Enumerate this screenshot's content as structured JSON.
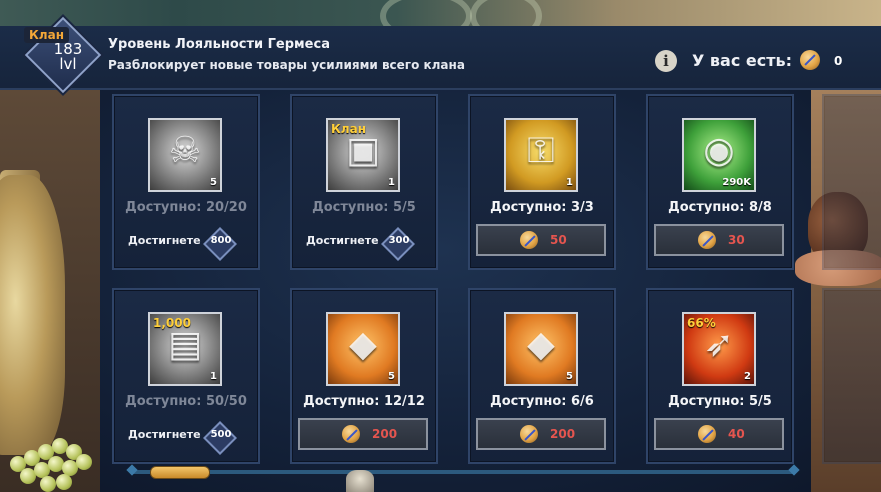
{
  "header": {
    "clan_tag": "Клан",
    "level": "183",
    "level_unit": "lvl",
    "title": "Уровень Лояльности Гермеса",
    "subtitle": "Разблокирует новые товары усилиями всего клана",
    "info_icon": "i",
    "have_label": "У вас есть:",
    "have_count": "0"
  },
  "items": [
    {
      "icon": "puzzle-skull-icon",
      "theme": "gray",
      "qty": "5",
      "corner": "",
      "available": "Доступно: 20/20",
      "locked": true,
      "reach_label": "Достигнете",
      "reach_value": "800"
    },
    {
      "icon": "chest-icon",
      "theme": "gray",
      "qty": "1",
      "corner": "Клан",
      "available": "Доступно: 5/5",
      "locked": true,
      "reach_label": "Достигнете",
      "reach_value": "300"
    },
    {
      "icon": "golden-key-icon",
      "theme": "gold",
      "qty": "1",
      "corner": "",
      "available": "Доступно: 3/3",
      "locked": false,
      "price": "50"
    },
    {
      "icon": "monster-mouth-icon",
      "theme": "green",
      "qty": "290K",
      "corner": "",
      "available": "Доступно: 8/8",
      "locked": false,
      "price": "30"
    },
    {
      "icon": "xp-book-icon",
      "theme": "gray",
      "qty": "1",
      "corner": "1,000",
      "available": "Доступно: 50/50",
      "locked": true,
      "reach_label": "Достигнете",
      "reach_value": "500"
    },
    {
      "icon": "puzzle-gem-icon",
      "theme": "orange",
      "qty": "5",
      "corner": "",
      "available": "Доступно: 12/12",
      "locked": false,
      "price": "200"
    },
    {
      "icon": "puzzle-gem-icon",
      "theme": "orange",
      "qty": "5",
      "corner": "",
      "available": "Доступно: 6/6",
      "locked": false,
      "price": "200"
    },
    {
      "icon": "winged-boot-icon",
      "theme": "red",
      "qty": "2",
      "corner": "66%",
      "available": "Доступно: 5/5",
      "locked": false,
      "price": "40"
    }
  ],
  "scroll": {
    "position": 0.02
  },
  "colors": {
    "price_text": "#e5554f",
    "clan_tag": "#f3a738",
    "dim_text": "#7f8798"
  }
}
